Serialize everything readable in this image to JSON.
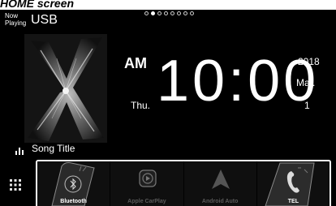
{
  "heading": "HOME screen",
  "status": {
    "now_playing_line1": "Now",
    "now_playing_line2": "Playing",
    "source": "USB"
  },
  "pager": {
    "total": 8,
    "active_index": 1
  },
  "clock": {
    "ampm": "AM",
    "weekday": "Thu.",
    "time": "10:00",
    "year": "2018",
    "month": "Mar.",
    "day": "1"
  },
  "track": {
    "title": "Song Title"
  },
  "dock": {
    "items": [
      {
        "label": "Bluetooth",
        "icon": "bluetooth-phone-icon",
        "enabled": true
      },
      {
        "label": "Apple CarPlay",
        "icon": "carplay-icon",
        "enabled": false
      },
      {
        "label": "Android Auto",
        "icon": "android-auto-icon",
        "enabled": false
      },
      {
        "label": "TEL",
        "icon": "telephone-handset-icon",
        "enabled": true
      }
    ]
  },
  "colors": {
    "screen_bg": "#000000",
    "text": "#ffffff",
    "dim_text": "#5a5a5a"
  }
}
